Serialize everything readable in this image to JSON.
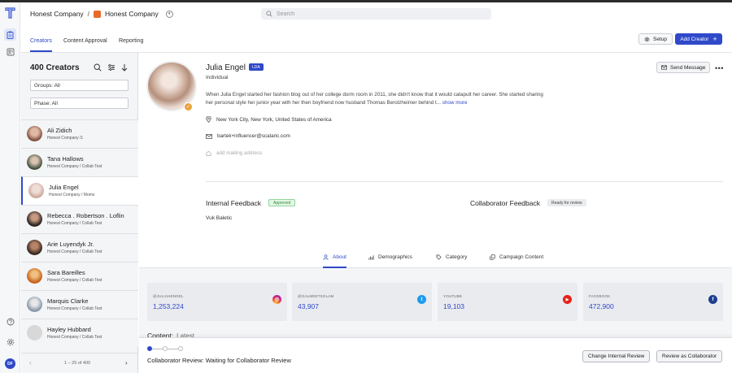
{
  "header": {
    "org": "Honest Company",
    "separator": "/",
    "brand": "Honest Company",
    "search_placeholder": "Search"
  },
  "tabs": [
    {
      "label": "Creators",
      "active": true
    },
    {
      "label": "Content Approval",
      "active": false
    },
    {
      "label": "Reporting",
      "active": false
    }
  ],
  "toolbar": {
    "setup_label": "Setup",
    "add_creator_label": "Add Creator"
  },
  "sidebar": {
    "title": "400 Creators",
    "groups_filter": "Groups: All",
    "phase_filter": "Phase: All",
    "creators": [
      {
        "name": "Ali Zidich",
        "sub": "Honest Company /1",
        "color": "#7a4b3a"
      },
      {
        "name": "Tana Hallows",
        "sub": "Honest Company / Collab Test",
        "color": "#3b4a3a"
      },
      {
        "name": "Julia Engel",
        "sub": "Honest Company / Moms",
        "color": "#c9a79a"
      },
      {
        "name": "Rebecca . Robertson . Loflin",
        "sub": "Honest Company / Collab Test",
        "color": "#2e2522"
      },
      {
        "name": "Arie Luyendyk Jr.",
        "sub": "Honest Company / Collab Test",
        "color": "#3a2a22"
      },
      {
        "name": "Sara Bareilles",
        "sub": "Honest Company / Collab Test",
        "color": "#c7641f"
      },
      {
        "name": "Marquis Clarke",
        "sub": "Honest Company / Collab Test",
        "color": "#8a9aa8"
      },
      {
        "name": "Hayley Hubbard",
        "sub": "Honest Company / Collab Test",
        "color": "#d8d8d8"
      }
    ],
    "pager": "1 – 25 of 400"
  },
  "profile": {
    "name": "Julia Engel",
    "badge": "LDA",
    "type": "Individual",
    "send_message": "Send Message",
    "bio": "When Julia Engel started her fashion blog out of her college dorm room in 2011, she didn't know that it would catapult her career. She started sharing her personal style her junior year with her then boyfriend now husband Thomas Berolzheimer behind t...",
    "show_more": "show more",
    "location": "New York City, New York, United States of America",
    "email": "bartek+influencer@scalaric.com",
    "mailing": "add mailing address"
  },
  "feedback": {
    "internal_title": "Internal Feedback",
    "internal_status": "Approved",
    "internal_name": "Vuk Baletic",
    "collab_title": "Collaborator Feedback",
    "collab_status": "Ready for review"
  },
  "profile_tabs": [
    {
      "label": "About",
      "active": true
    },
    {
      "label": "Demographics",
      "active": false
    },
    {
      "label": "Category",
      "active": false
    },
    {
      "label": "Campaign Content",
      "active": false
    }
  ],
  "stats": [
    {
      "label": "@JULIAHENGEL",
      "value": "1,253,224",
      "icon": "instagram-icon",
      "color": "#d62976"
    },
    {
      "label": "@GALMEETSGLAM",
      "value": "43,907",
      "icon": "twitter-icon",
      "color": "#1d9bf0"
    },
    {
      "label": "YOUTUBE",
      "value": "19,103",
      "icon": "youtube-icon",
      "color": "#e62117"
    },
    {
      "label": "FACEBOOK",
      "value": "472,900",
      "icon": "facebook-icon",
      "color": "#1f3f8f"
    }
  ],
  "content": {
    "title": "Content:",
    "filter": "Latest"
  },
  "footer": {
    "status": "Collaborator Review: Waiting for Collaborator Review",
    "change_internal": "Change Internal Review",
    "review_collab": "Review as Collaborator"
  },
  "user_initials": "DF",
  "accent": "#2f49c9"
}
